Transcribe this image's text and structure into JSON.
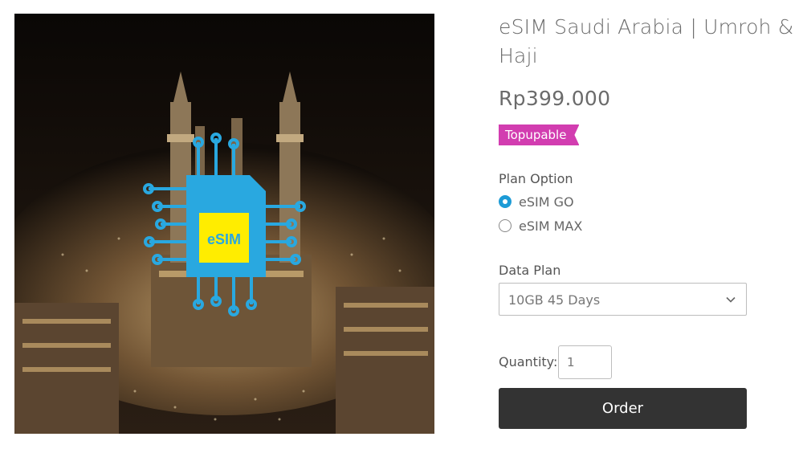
{
  "product": {
    "title": "eSIM Saudi Arabia | Umroh & Haji",
    "price": "Rp399.000",
    "badge": "Topupable",
    "image_chip_label": "eSIM"
  },
  "plan_option": {
    "label": "Plan Option",
    "options": [
      {
        "label": "eSIM GO",
        "selected": true
      },
      {
        "label": "eSIM MAX",
        "selected": false
      }
    ]
  },
  "data_plan": {
    "label": "Data Plan",
    "selected": "10GB 45 Days",
    "icon": "chevron-down-icon"
  },
  "quantity": {
    "label": "Quantity:",
    "value": "1"
  },
  "order": {
    "label": "Order"
  },
  "colors": {
    "badge": "#d23db0",
    "radio_selected": "#1d9bd6",
    "order_button": "#333333",
    "sim_card": "#29a8e0",
    "sim_chip": "#ffed00"
  }
}
